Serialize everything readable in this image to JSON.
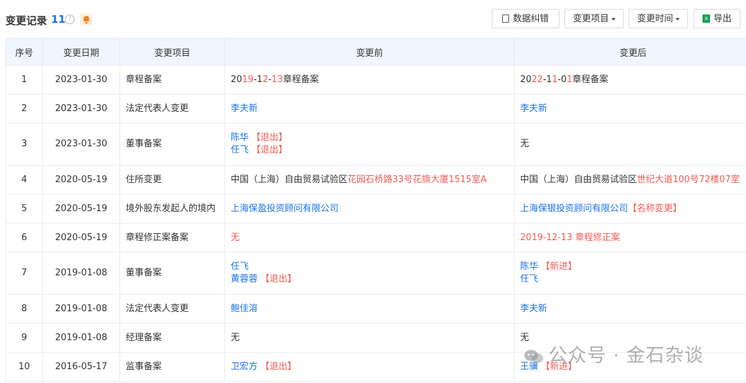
{
  "header": {
    "title": "变更记录",
    "count": "11",
    "help_glyph": "?",
    "buttons": {
      "correction": "数据纠错",
      "item_filter": "变更项目",
      "time_filter": "变更时间",
      "export": "导出",
      "export_icon_glyph": "x"
    }
  },
  "columns": [
    "序号",
    "变更日期",
    "变更项目",
    "变更前",
    "变更后"
  ],
  "rows": [
    {
      "no": "1",
      "date": "2023-01-30",
      "item": "章程备案",
      "before": [
        [
          {
            "t": "20",
            "s": ""
          },
          {
            "t": "19",
            "s": "red"
          },
          {
            "t": "-1",
            "s": ""
          },
          {
            "t": "2",
            "s": "red"
          },
          {
            "t": "-",
            "s": ""
          },
          {
            "t": "13",
            "s": "red"
          },
          {
            "t": "章程备案",
            "s": ""
          }
        ]
      ],
      "after": [
        [
          {
            "t": "20",
            "s": ""
          },
          {
            "t": "22",
            "s": "red"
          },
          {
            "t": "-1",
            "s": ""
          },
          {
            "t": "1",
            "s": "red"
          },
          {
            "t": "-0",
            "s": ""
          },
          {
            "t": "1",
            "s": "red"
          },
          {
            "t": "章程备案",
            "s": ""
          }
        ]
      ]
    },
    {
      "no": "2",
      "date": "2023-01-30",
      "item": "法定代表人变更",
      "before": [
        [
          {
            "t": "李夫新",
            "s": "blue"
          }
        ]
      ],
      "after": [
        [
          {
            "t": "李夫新",
            "s": "blue"
          }
        ]
      ]
    },
    {
      "no": "3",
      "date": "2023-01-30",
      "item": "董事备案",
      "tall": true,
      "before": [
        [
          {
            "t": "陈华",
            "s": "blue"
          },
          {
            "t": " 【退出】",
            "s": "tag"
          }
        ],
        [
          {
            "t": "任飞",
            "s": "blue"
          },
          {
            "t": " 【退出】",
            "s": "tag"
          }
        ]
      ],
      "after": [
        [
          {
            "t": "无",
            "s": ""
          }
        ]
      ]
    },
    {
      "no": "4",
      "date": "2020-05-19",
      "item": "住所变更",
      "before": [
        [
          {
            "t": "中国（上海）自由贸易试验区",
            "s": ""
          },
          {
            "t": "花园石桥路33号花旗大厦1515室A",
            "s": "red"
          }
        ]
      ],
      "after": [
        [
          {
            "t": "中国（上海）自由贸易试验区",
            "s": ""
          },
          {
            "t": "世纪大道100号72楼07室",
            "s": "red"
          }
        ]
      ]
    },
    {
      "no": "5",
      "date": "2020-05-19",
      "item": "境外股东发起人的境内",
      "before": [
        [
          {
            "t": "上海保盈投资顾问有限公司",
            "s": "blue"
          }
        ]
      ],
      "after": [
        [
          {
            "t": "上海保银投资顾问有限公司",
            "s": "blue"
          },
          {
            "t": "【名称变更】",
            "s": "tag"
          }
        ]
      ]
    },
    {
      "no": "6",
      "date": "2020-05-19",
      "item": "章程修正案备案",
      "before": [
        [
          {
            "t": "无",
            "s": "red"
          }
        ]
      ],
      "after": [
        [
          {
            "t": "2019-12-13 章程修正案",
            "s": "red"
          }
        ]
      ]
    },
    {
      "no": "7",
      "date": "2019-01-08",
      "item": "董事备案",
      "tall": true,
      "before": [
        [
          {
            "t": "任飞",
            "s": "blue"
          }
        ],
        [
          {
            "t": "黄蓉蓉",
            "s": "blue"
          },
          {
            "t": " 【退出】",
            "s": "tag"
          }
        ]
      ],
      "after": [
        [
          {
            "t": "陈华",
            "s": "blue"
          },
          {
            "t": " 【新进】",
            "s": "tag"
          }
        ],
        [
          {
            "t": "任飞",
            "s": "blue"
          }
        ]
      ]
    },
    {
      "no": "8",
      "date": "2019-01-08",
      "item": "法定代表人变更",
      "before": [
        [
          {
            "t": "鲍佳溶",
            "s": "blue"
          }
        ]
      ],
      "after": [
        [
          {
            "t": "李夫新",
            "s": "blue"
          }
        ]
      ]
    },
    {
      "no": "9",
      "date": "2019-01-08",
      "item": "经理备案",
      "before": [
        [
          {
            "t": "无",
            "s": ""
          }
        ]
      ],
      "after": [
        [
          {
            "t": "无",
            "s": ""
          }
        ]
      ]
    },
    {
      "no": "10",
      "date": "2016-05-17",
      "item": "监事备案",
      "before": [
        [
          {
            "t": "卫宏方",
            "s": "blue"
          },
          {
            "t": " 【退出】",
            "s": "tag"
          }
        ]
      ],
      "after": [
        [
          {
            "t": "王骥",
            "s": "blue"
          },
          {
            "t": " 【新进】",
            "s": "tag"
          }
        ]
      ]
    }
  ],
  "watermark": "公众号 · 金石杂谈",
  "colors": {
    "accent": "#1a73e8",
    "changed": "#f25c54",
    "header_bg": "#f0f6fd"
  }
}
